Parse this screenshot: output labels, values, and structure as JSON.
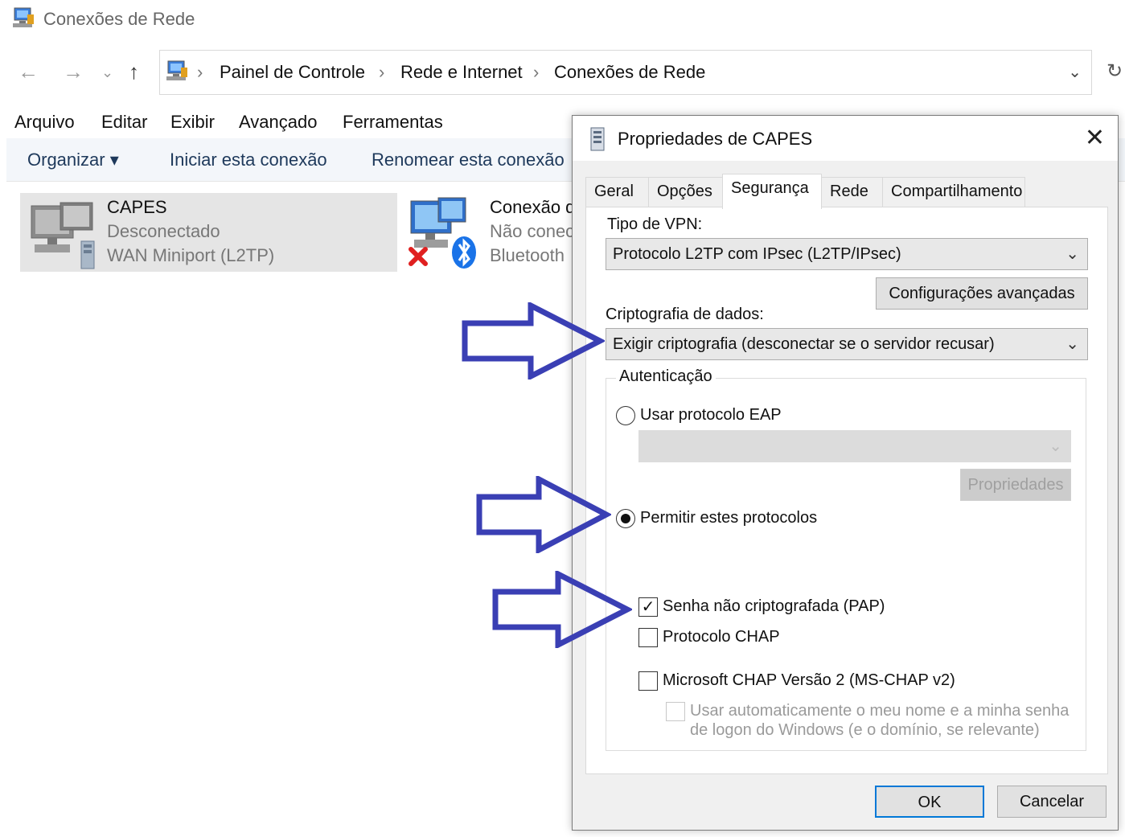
{
  "window": {
    "title": "Conexões de Rede"
  },
  "address": {
    "crumbs": [
      "Painel de Controle",
      "Rede e Internet",
      "Conexões de Rede"
    ],
    "separator": "›"
  },
  "menu": [
    "Arquivo",
    "Editar",
    "Exibir",
    "Avançado",
    "Ferramentas"
  ],
  "commands": {
    "organize": "Organizar ▾",
    "start": "Iniciar esta conexão",
    "rename": "Renomear esta conexão"
  },
  "connections": [
    {
      "name": "CAPES",
      "status": "Desconectado",
      "device": "WAN Miniport (L2TP)"
    },
    {
      "name": "Conexão d",
      "status": "Não conec",
      "device": "Bluetooth"
    }
  ],
  "dialog": {
    "title": "Propriedades de CAPES",
    "tabs": [
      "Geral",
      "Opções",
      "Segurança",
      "Rede",
      "Compartilhamento"
    ],
    "active_tab": "Segurança",
    "vpn_type_label": "Tipo de VPN:",
    "vpn_type_value": "Protocolo L2TP com IPsec (L2TP/IPsec)",
    "advanced_button": "Configurações avançadas",
    "encryption_label": "Criptografia de dados:",
    "encryption_value": "Exigir criptografia (desconectar se o servidor recusar)",
    "auth_group_label": "Autenticação",
    "eap_radio_label": "Usar protocolo EAP",
    "properties_button": "Propriedades",
    "allow_radio_label": "Permitir estes protocolos",
    "pap_label": "Senha não criptografada (PAP)",
    "chap_label": "Protocolo CHAP",
    "mschap_label": "Microsoft CHAP Versão 2 (MS-CHAP v2)",
    "auto_logon_line1": "Usar automaticamente o meu nome e a minha senha",
    "auto_logon_line2": "de logon do Windows (e o domínio, se relevante)",
    "ok_button": "OK",
    "cancel_button": "Cancelar"
  },
  "colors": {
    "annotation_arrow": "#3a3fb4",
    "command_text": "#1e395b"
  }
}
